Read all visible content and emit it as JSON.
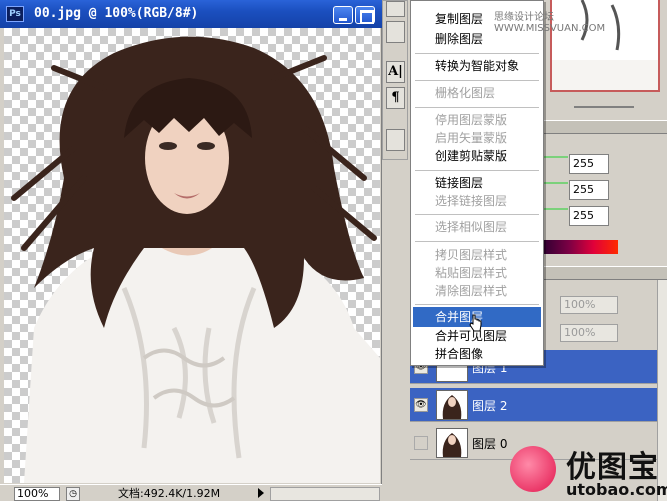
{
  "document": {
    "title": "00.jpg @ 100%(RGB/8#)",
    "zoom": "100%",
    "doc_info": "文档:492.4K/1.92M"
  },
  "tools": [
    "A|",
    "¶"
  ],
  "context_menu": {
    "items": [
      {
        "label": "复制图层",
        "disabled": false
      },
      {
        "label": "删除图层",
        "disabled": false
      },
      {
        "label": "转换为智能对象",
        "disabled": false
      },
      {
        "label": "栅格化图层",
        "disabled": true
      },
      {
        "label": "停用图层蒙版",
        "disabled": true
      },
      {
        "label": "启用矢量蒙版",
        "disabled": true
      },
      {
        "label": "创建剪贴蒙版",
        "disabled": false
      },
      {
        "label": "链接图层",
        "disabled": false
      },
      {
        "label": "选择链接图层",
        "disabled": true
      },
      {
        "label": "选择相似图层",
        "disabled": true
      },
      {
        "label": "拷贝图层样式",
        "disabled": true
      },
      {
        "label": "粘贴图层样式",
        "disabled": true
      },
      {
        "label": "清除图层样式",
        "disabled": true
      },
      {
        "label": "合并图层",
        "disabled": false,
        "highlighted": true
      },
      {
        "label": "合并可见图层",
        "disabled": false
      },
      {
        "label": "拼合图像",
        "disabled": false
      }
    ]
  },
  "color_panel": {
    "values": [
      "255",
      "255",
      "255"
    ]
  },
  "layers_panel": {
    "opacity_label": "度:",
    "opacity_value": "100%",
    "fill_label": "充:",
    "fill_value": "100%",
    "layers": [
      {
        "name": "图层 1",
        "selected": true,
        "visible": true
      },
      {
        "name": "图层 2",
        "selected": true,
        "visible": true
      },
      {
        "name": "图层 0",
        "selected": false,
        "visible": false
      }
    ]
  },
  "watermarks": {
    "top": "思缘设计论坛 WWW.MISSVUAN.COM",
    "logo_cn": "优图宝",
    "logo_url": "utobao.com"
  },
  "colors": {
    "titlebar": "#1b4fbf",
    "selection": "#316ac5",
    "layer_selected": "#3b63c2"
  }
}
